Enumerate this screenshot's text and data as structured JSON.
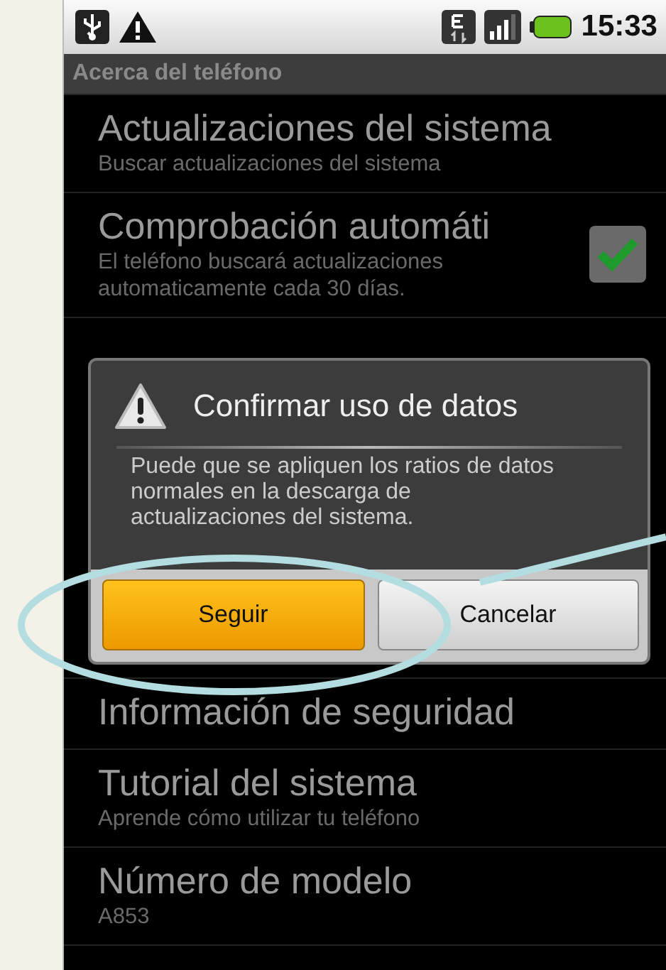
{
  "status_bar": {
    "time": "15:33"
  },
  "title": "Acerca del teléfono",
  "items_above": [
    {
      "kind": "plain",
      "title": "Actualizaciones del sistema",
      "summary": "Buscar actualizaciones del sistema"
    },
    {
      "kind": "checkbox",
      "title": "Comprobación automáti",
      "summary": "El teléfono buscará actualizaciones automaticamente cada 30 días.",
      "checked": true
    }
  ],
  "dialog": {
    "title": "Confirmar uso de datos",
    "message": "Puede que se apliquen los ratios de datos normales en la descarga de actualizaciones del sistema.",
    "buttons": [
      {
        "label": "Seguir",
        "selected": true
      },
      {
        "label": "Cancelar",
        "selected": false
      }
    ]
  },
  "items_below": [
    {
      "title": "Información de seguridad"
    },
    {
      "title": "Tutorial del sistema",
      "summary": "Aprende cómo utilizar tu teléfono"
    },
    {
      "title": "Número de modelo",
      "summary": "A853"
    }
  ]
}
